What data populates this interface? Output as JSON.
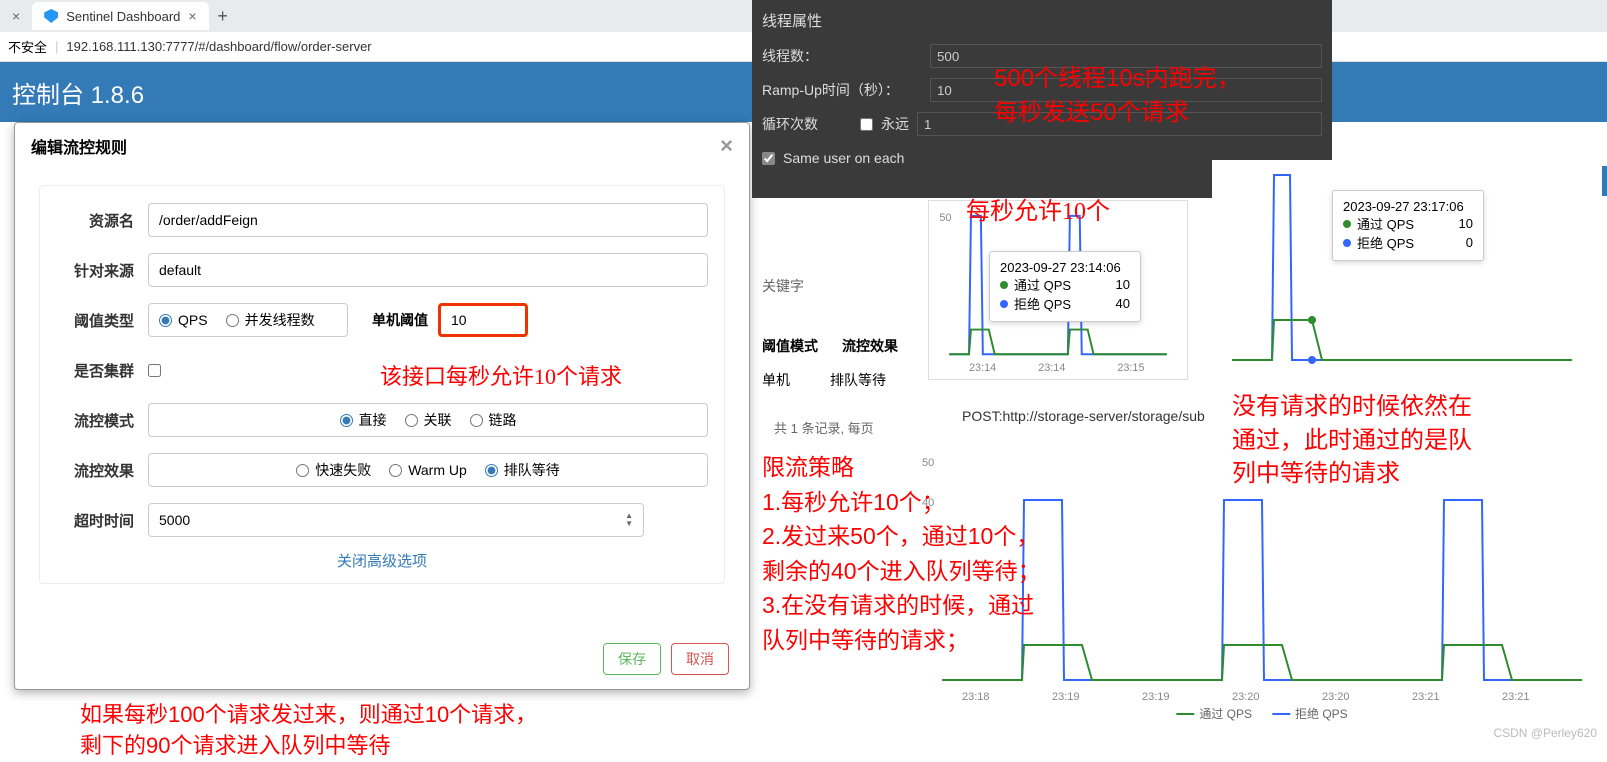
{
  "browser": {
    "tab_title": "Sentinel Dashboard",
    "close": "×",
    "new_tab": "+",
    "security_hint": "不安全",
    "url": "192.168.111.130:7777/#/dashboard/flow/order-server"
  },
  "banner": {
    "title": "控制台 1.8.6",
    "sub": ".6"
  },
  "dialog": {
    "title": "编辑流控规则",
    "labels": {
      "resource": "资源名",
      "source": "针对来源",
      "threshold_type": "阈值类型",
      "single_threshold": "单机阈值",
      "cluster": "是否集群",
      "mode": "流控模式",
      "effect": "流控效果",
      "timeout": "超时时间"
    },
    "values": {
      "resource": "/order/addFeign",
      "source": "default",
      "threshold": "10",
      "timeout": "5000"
    },
    "radios": {
      "qps": "QPS",
      "concurrent": "并发线程数",
      "direct": "直接",
      "relate": "关联",
      "chain": "链路",
      "fail_fast": "快速失败",
      "warmup": "Warm Up",
      "queue": "排队等待"
    },
    "advanced": "关闭高级选项",
    "save": "保存",
    "cancel": "取消"
  },
  "annotations": {
    "a1": "该接口每秒允许10个请求",
    "a2_l1": "如果每秒100个请求发过来，则通过10个请求，",
    "a2_l2": "剩下的90个请求进入队列中等待",
    "jm1": "500个线程10s内跑完，",
    "jm2": "每秒发送50个请求",
    "allow10": "每秒允许10个",
    "right_l1": "没有请求的时候依然在",
    "right_l2": "通过，此时通过的是队",
    "right_l3": "列中等待的请求",
    "policy_t": "限流策略",
    "policy_1": "1.每秒允许10个；",
    "policy_2a": "2.发过来50个，通过10个，",
    "policy_2b": "剩余的40个进入队列等待；",
    "policy_3a": "3.在没有请求的时候，通过",
    "policy_3b": "队列中等待的请求；"
  },
  "jmeter": {
    "section": "线程属性",
    "threads_lab": "线程数：",
    "threads_val": "500",
    "ramp_lab": "Ramp-Up时间（秒）：",
    "ramp_val": "10",
    "loop_lab": "循环次数",
    "forever": "永远",
    "loop_val": "1",
    "same_user": "Same user on each"
  },
  "table": {
    "col_mode": "阈值模式",
    "col_effect": "流控效果",
    "val_mode": "单机",
    "val_effect": "排队等待",
    "pagination": "共 1 条记录, 每页",
    "keyword": "关键字"
  },
  "charts": {
    "tooltip1_time": "2023-09-27 23:14:06",
    "tooltip2_time": "2023-09-27 23:17:06",
    "pass_qps": "通过 QPS",
    "reject_qps": "拒绝 QPS",
    "t1_pass": "10",
    "t1_reject": "40",
    "t2_pass": "10",
    "t2_reject": "0",
    "post_url": "POST:http://storage-server/storage/sub",
    "x1": [
      "23:14",
      "23:14",
      "23:15"
    ],
    "y1": "50",
    "y2": "50",
    "y2b": "40",
    "x3": [
      "23:18",
      "23:19",
      "23:19",
      "23:20",
      "23:20",
      "23:21",
      "23:21"
    ],
    "legend_pass": "通过 QPS",
    "legend_reject": "拒绝 QPS"
  },
  "chart_data": [
    {
      "type": "line",
      "title": "mini-left",
      "x_ticks": [
        "23:14",
        "23:14",
        "23:15"
      ],
      "ylim": [
        0,
        50
      ],
      "series": [
        {
          "name": "通过 QPS",
          "color": "#2e8b2e",
          "peaks": [
            10,
            10
          ]
        },
        {
          "name": "拒绝 QPS",
          "color": "#3366ff",
          "peaks": [
            50,
            50
          ]
        }
      ],
      "sampled_point": {
        "time": "2023-09-27 23:14:06",
        "通过 QPS": 10,
        "拒绝 QPS": 40
      }
    },
    {
      "type": "line",
      "title": "mini-right",
      "ylim": [
        0,
        50
      ],
      "series": [
        {
          "name": "通过 QPS",
          "color": "#2e8b2e",
          "peaks": [
            10
          ]
        },
        {
          "name": "拒绝 QPS",
          "color": "#3366ff",
          "peaks": [
            50
          ]
        }
      ],
      "sampled_point": {
        "time": "2023-09-27 23:17:06",
        "通过 QPS": 10,
        "拒绝 QPS": 0
      }
    },
    {
      "type": "line",
      "title": "big",
      "x_ticks": [
        "23:18",
        "23:19",
        "23:19",
        "23:20",
        "23:20",
        "23:21",
        "23:21"
      ],
      "ylim": [
        0,
        50
      ],
      "series": [
        {
          "name": "通过 QPS",
          "color": "#2e8b2e",
          "peaks": [
            10,
            10,
            10
          ]
        },
        {
          "name": "拒绝 QPS",
          "color": "#3366ff",
          "peaks": [
            40,
            40,
            40
          ]
        }
      ]
    }
  ],
  "watermark": "CSDN @Perley620"
}
